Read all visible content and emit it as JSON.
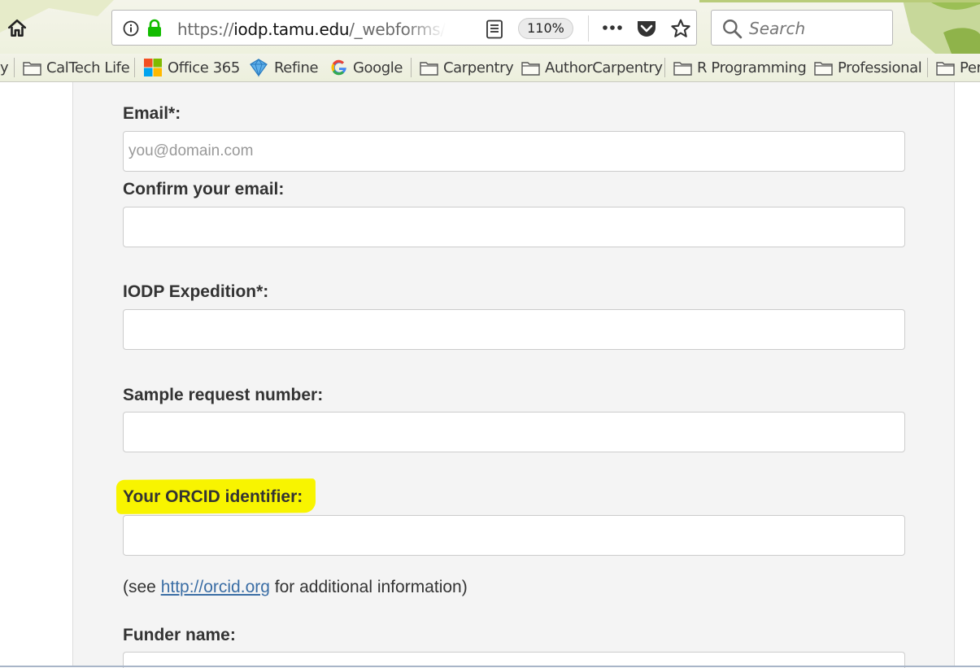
{
  "browser": {
    "url": {
      "scheme": "https://",
      "host": "iodp.tamu.edu",
      "path": "/_webforms/i"
    },
    "zoom": "110%",
    "search_placeholder": "Search",
    "bookmarks": [
      {
        "label": "y",
        "icon": "folder-icon"
      },
      {
        "label": "CalTech Life",
        "icon": "folder-icon"
      },
      {
        "label": "Office 365",
        "icon": "office365-icon"
      },
      {
        "label": "Refine",
        "icon": "refine-icon"
      },
      {
        "label": "Google",
        "icon": "google-icon"
      },
      {
        "label": "Carpentry",
        "icon": "folder-icon"
      },
      {
        "label": "AuthorCarpentry",
        "icon": "folder-icon"
      },
      {
        "label": "R Programming",
        "icon": "folder-icon"
      },
      {
        "label": "Professional",
        "icon": "folder-icon"
      },
      {
        "label": "Per",
        "icon": "folder-icon"
      }
    ]
  },
  "form": {
    "email": {
      "label": "Email*:",
      "placeholder": "you@domain.com",
      "value": ""
    },
    "confirm_email": {
      "label": "Confirm your email:",
      "value": ""
    },
    "expedition": {
      "label": "IODP Expedition*:",
      "value": ""
    },
    "sample_request": {
      "label": "Sample request number:",
      "value": ""
    },
    "orcid": {
      "label": "Your ORCID identifier:",
      "value": ""
    },
    "orcid_help": {
      "prefix": "(see ",
      "link": "http://orcid.org",
      "suffix": " for additional information)"
    },
    "funder": {
      "label": "Funder name:"
    }
  },
  "colors": {
    "highlight": "#f8f400",
    "link": "#3b6ea5",
    "lock": "#12bc00"
  }
}
